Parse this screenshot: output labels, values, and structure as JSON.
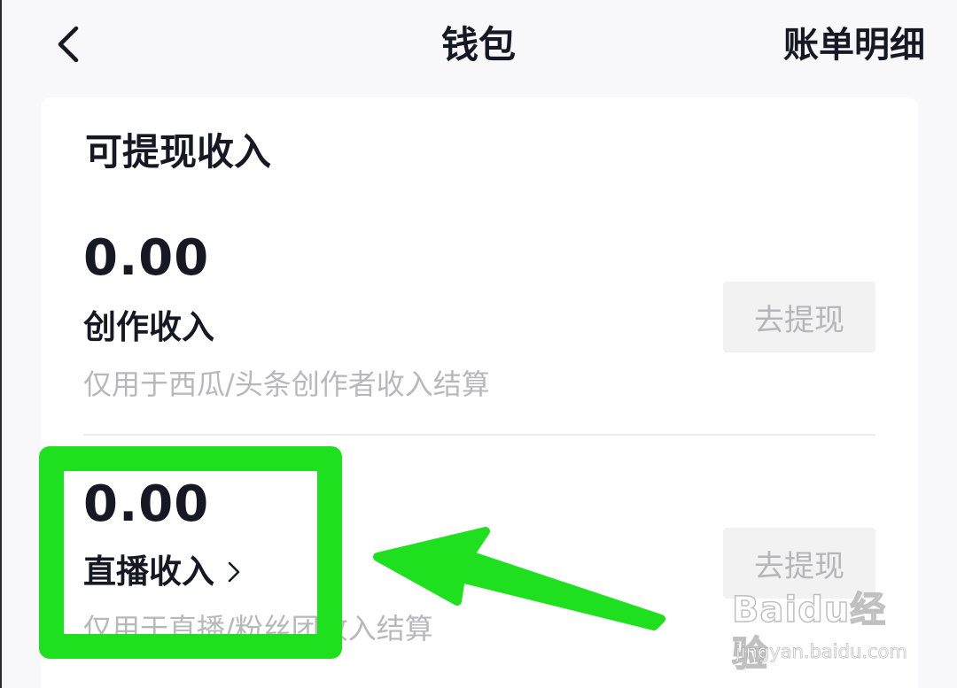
{
  "header": {
    "title": "钱包",
    "bill_link": "账单明细"
  },
  "section": {
    "title": "可提现收入"
  },
  "incomes": [
    {
      "amount": "0.00",
      "label": "创作收入",
      "description": "仅用于西瓜/头条创作者收入结算",
      "button_label": "去提现"
    },
    {
      "amount": "0.00",
      "label": "直播收入",
      "description": "仅用于直播/粉丝团收入结算",
      "button_label": "去提现"
    }
  ],
  "icons": {
    "back": "chevron-left-icon",
    "live_chevron": "chevron-right-icon"
  },
  "annotation": {
    "color": "#1fe01f"
  },
  "watermark": {
    "logo": "Baidu经验",
    "url": "jingyan.baidu.com"
  }
}
